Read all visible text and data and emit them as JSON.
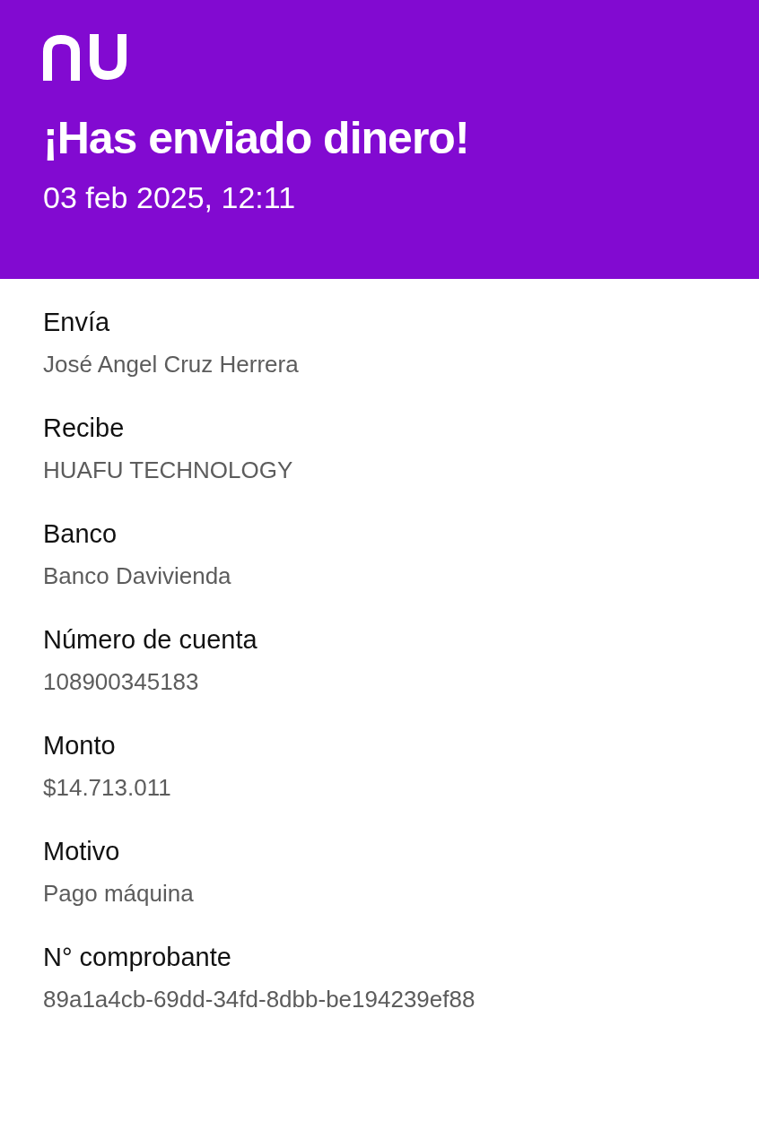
{
  "header": {
    "title": "¡Has enviado dinero!",
    "date": "03 feb 2025, 12:11"
  },
  "fields": [
    {
      "label": "Envía",
      "value": "José Angel Cruz Herrera"
    },
    {
      "label": "Recibe",
      "value": "HUAFU TECHNOLOGY"
    },
    {
      "label": "Banco",
      "value": "Banco Davivienda"
    },
    {
      "label": "Número de cuenta",
      "value": "108900345183"
    },
    {
      "label": "Monto",
      "value": "$14.713.011"
    },
    {
      "label": "Motivo",
      "value": "Pago máquina"
    },
    {
      "label": "N° comprobante",
      "value": "89a1a4cb-69dd-34fd-8dbb-be194239ef88"
    }
  ]
}
